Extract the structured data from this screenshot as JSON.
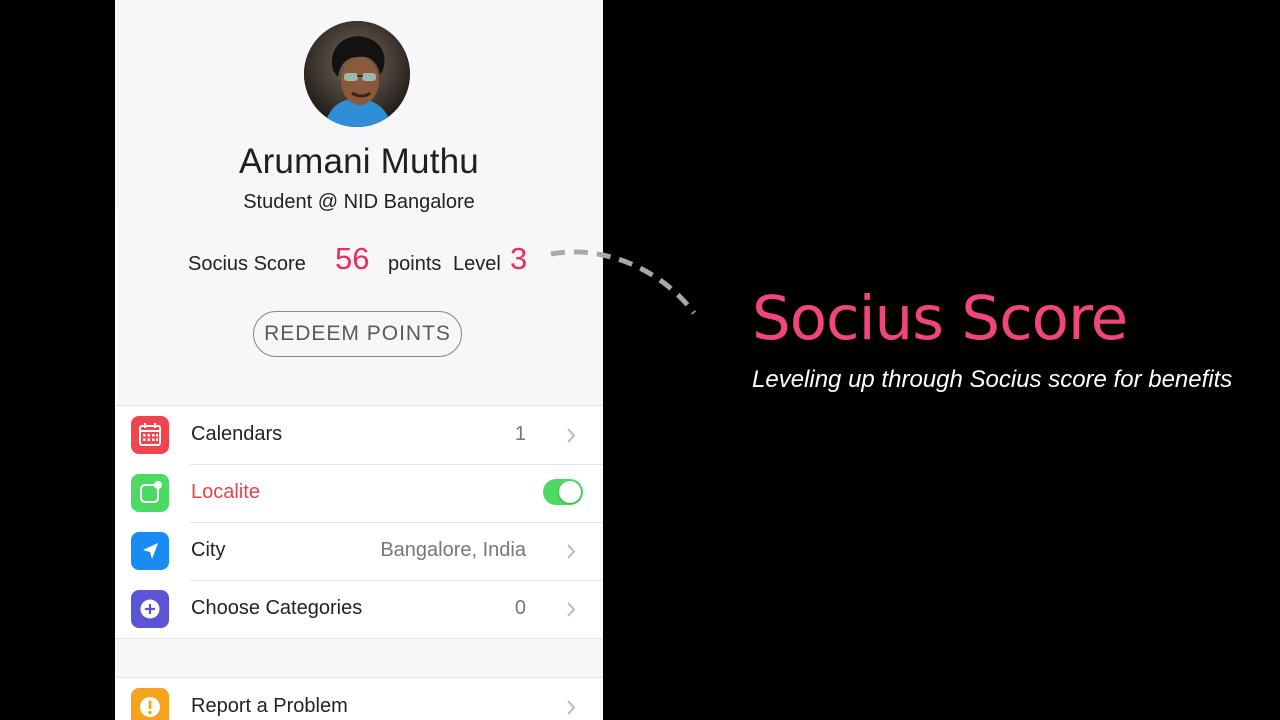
{
  "profile": {
    "name": "Arumani Muthu",
    "subtitle": "Student @ NID Bangalore"
  },
  "score": {
    "label": "Socius Score",
    "points": "56",
    "points_word": "points",
    "level_word": "Level",
    "level": "3",
    "accent_color": "#ea2d5b"
  },
  "redeem": {
    "label": "REDEEM POINTS"
  },
  "settings": {
    "items": [
      {
        "icon": "calendar-icon",
        "label": "Calendars",
        "value": "1",
        "color": "#f2444c"
      },
      {
        "icon": "localite-icon",
        "label": "Localite",
        "toggle": true,
        "color": "#4cd964"
      },
      {
        "icon": "location-arrow-icon",
        "label": "City",
        "value": "Bangalore, India",
        "color": "#1a8bf3"
      },
      {
        "icon": "plus-circle-icon",
        "label": "Choose Categories",
        "value": "0",
        "color": "#5b55d6"
      }
    ],
    "support": [
      {
        "icon": "exclamation-icon",
        "label": "Report a Problem",
        "color": "#f6a21c"
      }
    ]
  },
  "annotation": {
    "title": "Socius Score",
    "subtitle": "Leveling up through Socius score for benefits",
    "title_color": "#f0467a"
  }
}
